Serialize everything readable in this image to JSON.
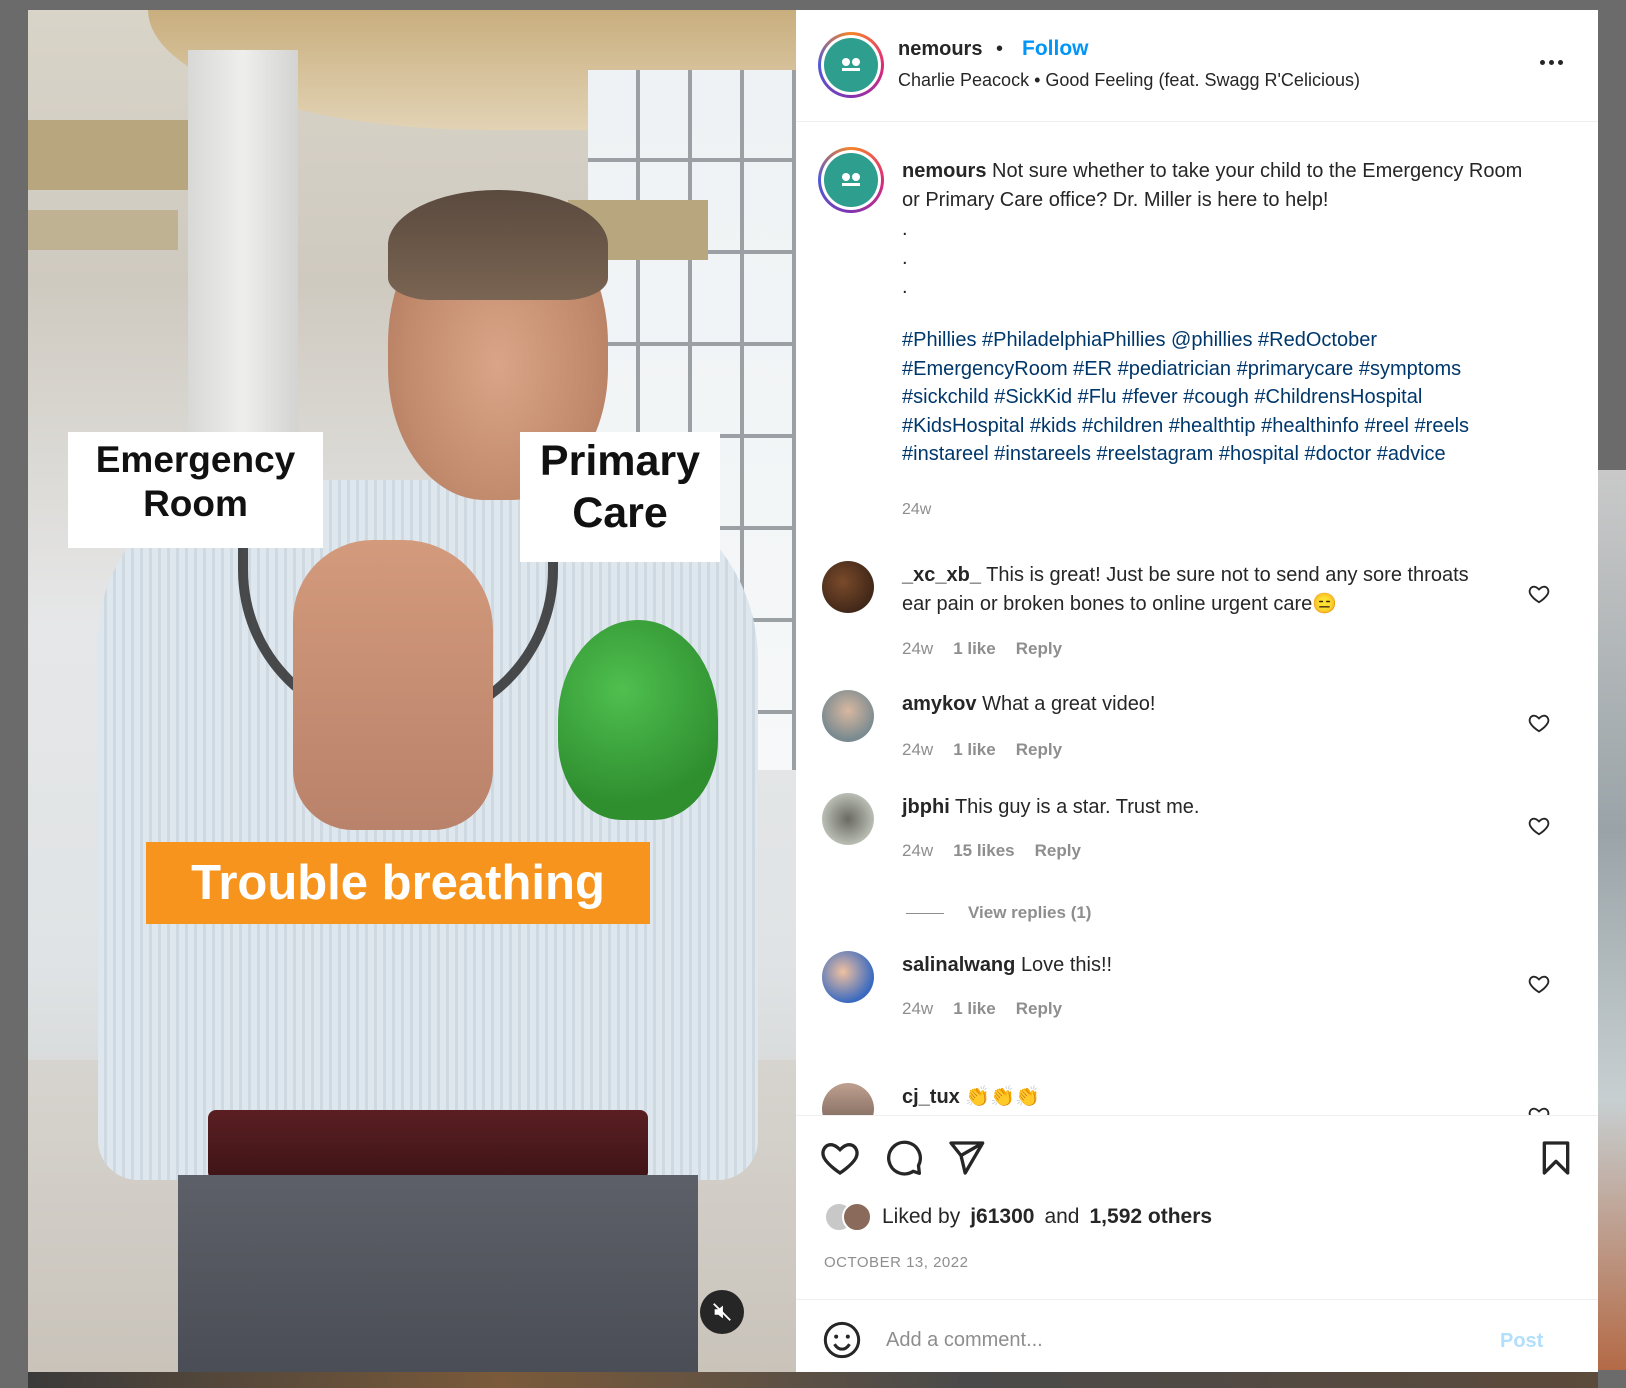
{
  "media": {
    "label_er": "Emergency Room",
    "label_pc": "Primary Care",
    "label_trouble": "Trouble breathing",
    "mute_icon": "speaker-muted-icon"
  },
  "header": {
    "username": "nemours",
    "separator": "•",
    "follow_label": "Follow",
    "audio": "Charlie Peacock • Good Feeling (feat. Swagg R'Celicious)",
    "more_icon": "more-options-icon",
    "avatar_color": "#2e9e8f"
  },
  "caption": {
    "username": "nemours",
    "text": "Not sure whether to take your child to the Emergency Room or Primary Care office? Dr. Miller is here to help!",
    "dots": ".\n.\n.",
    "hashtags": "#Phillies #PhiladelphiaPhillies @phillies #RedOctober #EmergencyRoom #ER #pediatrician #primarycare #symptoms #sickchild #SickKid #Flu #fever #cough #ChildrensHospital #KidsHospital #kids #children #healthtip #healthinfo #reel #reels #instareel #instareels #reelstagram #hospital #doctor #advice",
    "time": "24w"
  },
  "comments": [
    {
      "username": "_xc_xb_",
      "text": "This is great! Just be sure not to send any sore throats ear pain or broken bones to online urgent care😑",
      "time": "24w",
      "likes": "1 like",
      "reply": "Reply"
    },
    {
      "username": "amykov",
      "text": "What a great video!",
      "time": "24w",
      "likes": "1 like",
      "reply": "Reply"
    },
    {
      "username": "jbphi",
      "text": "This guy is a star. Trust me.",
      "time": "24w",
      "likes": "15 likes",
      "reply": "Reply"
    },
    {
      "username": "salinalwang",
      "text": "Love this!!",
      "time": "24w",
      "likes": "1 like",
      "reply": "Reply"
    },
    {
      "username": "cj_tux",
      "text": "👏👏👏",
      "time": "",
      "likes": "",
      "reply": ""
    }
  ],
  "view_replies": "View replies (1)",
  "actions": {
    "like_icon": "heart-icon",
    "comment_icon": "comment-bubble-icon",
    "share_icon": "send-icon",
    "save_icon": "bookmark-icon",
    "liked_prefix": "Liked by",
    "liked_user": "j61300",
    "liked_and": "and",
    "liked_count": "1,592 others",
    "date": "OCTOBER 13, 2022"
  },
  "add_comment": {
    "placeholder": "Add a comment...",
    "post_label": "Post",
    "emoji_icon": "smiley-icon"
  },
  "colors": {
    "follow": "#0095f6",
    "hashtag": "#00376b",
    "muted": "#8e8e8e",
    "trouble_bg": "#f7941d",
    "post_disabled": "#b2dffc"
  }
}
